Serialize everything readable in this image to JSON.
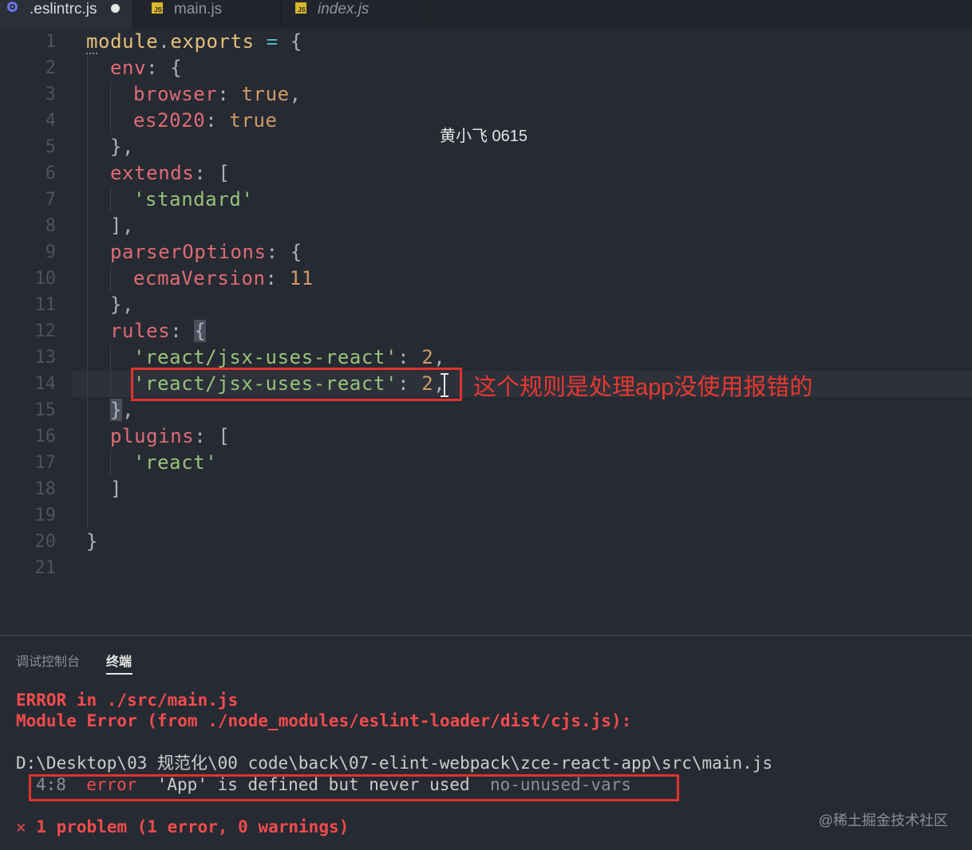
{
  "tabs": [
    {
      "label": ".eslintrc.js",
      "icon": "eslint-icon",
      "modified": true
    },
    {
      "label": "main.js",
      "icon": "js-icon"
    },
    {
      "label": "index.js",
      "icon": "js-icon",
      "preview": true
    }
  ],
  "js_badge": "JS",
  "editor": {
    "line_numbers": [
      "1",
      "2",
      "3",
      "4",
      "5",
      "6",
      "7",
      "8",
      "9",
      "10",
      "11",
      "12",
      "13",
      "14",
      "15",
      "16",
      "17",
      "18",
      "19",
      "20",
      "21"
    ],
    "lines": {
      "l1": [
        "module",
        ".",
        "exports",
        " = ",
        "{"
      ],
      "l2": [
        "env",
        ": {"
      ],
      "l3": [
        "browser",
        ": ",
        "true",
        ","
      ],
      "l4": [
        "es2020",
        ": ",
        "true"
      ],
      "l5": [
        "},"
      ],
      "l6": [
        "extends",
        ": ["
      ],
      "l7": [
        "'standard'"
      ],
      "l8": [
        "],"
      ],
      "l9": [
        "parserOptions",
        ": {"
      ],
      "l10": [
        "ecmaVersion",
        ": ",
        "11"
      ],
      "l11": [
        "},"
      ],
      "l12": [
        "rules",
        ": ",
        "{"
      ],
      "l13": [
        "'react/jsx-uses-react'",
        ": ",
        "2",
        ","
      ],
      "l14": [
        "'react/jsx-uses-react'",
        ": ",
        "2",
        ","
      ],
      "l15": [
        "}",
        ","
      ],
      "l16": [
        "plugins",
        ": ["
      ],
      "l17": [
        "'react'"
      ],
      "l18": [
        "]"
      ],
      "l20": [
        "}"
      ]
    },
    "watermark": "黄小飞 0615",
    "annotation": "这个规则是处理app没使用报错的"
  },
  "panel": {
    "tabs": [
      "调试控制台",
      "终端"
    ],
    "active_tab": "终端",
    "terminal": {
      "line1": "ERROR in ./src/main.js",
      "line2": "Module Error (from ./node_modules/eslint-loader/dist/cjs.js):",
      "path": "D:\\Desktop\\03 规范化\\00 code\\back\\07-elint-webpack\\zce-react-app\\src\\main.js",
      "err_pos": "4:8",
      "err_level": "error",
      "err_msg": "'App' is defined but never used",
      "err_rule": "no-unused-vars",
      "summary_icon": "✕",
      "summary": "1 problem (1 error, 0 warnings)"
    }
  },
  "site_watermark": "@稀土掘金技术社区"
}
